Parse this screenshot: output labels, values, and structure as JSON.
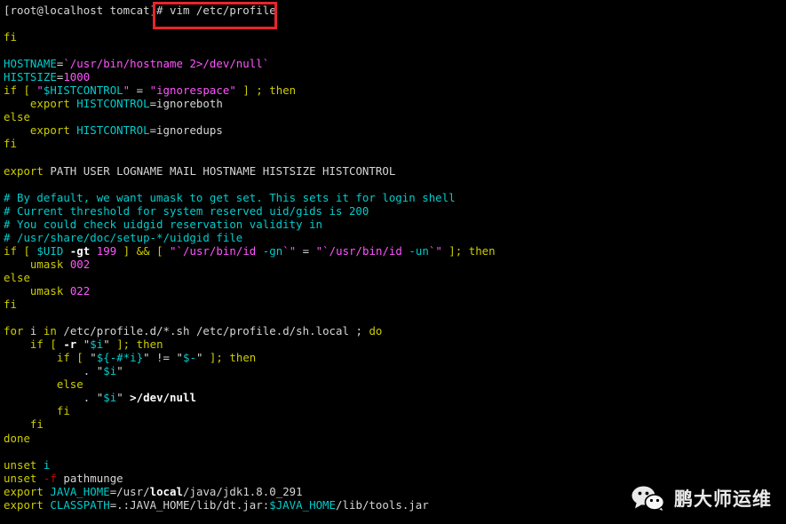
{
  "terminal": {
    "prompt": "[root@localhost tomcat]#",
    "command": "vim /etc/profile",
    "highlight_color": "#e8252a",
    "background_color": "#000000",
    "palette": {
      "white": "#d6d6d6",
      "yellow": "#cdcd00",
      "cyan": "#00cdcd",
      "magenta": "#cd00cd",
      "red": "#cd0000",
      "bold_white": "#ffffff"
    }
  },
  "file": {
    "path": "/etc/profile",
    "lines": [
      "fi",
      "",
      "HOSTNAME=`/usr/bin/hostname 2>/dev/null`",
      "HISTSIZE=1000",
      "if [ \"$HISTCONTROL\" = \"ignorespace\" ] ; then",
      "    export HISTCONTROL=ignoreboth",
      "else",
      "    export HISTCONTROL=ignoredups",
      "fi",
      "",
      "export PATH USER LOGNAME MAIL HOSTNAME HISTSIZE HISTCONTROL",
      "",
      "# By default, we want umask to get set. This sets it for login shell",
      "# Current threshold for system reserved uid/gids is 200",
      "# You could check uidgid reservation validity in",
      "# /usr/share/doc/setup-*/uidgid file",
      "if [ $UID -gt 199 ] && [ \"`/usr/bin/id -gn`\" = \"`/usr/bin/id -un`\" ]; then",
      "    umask 002",
      "else",
      "    umask 022",
      "fi",
      "",
      "for i in /etc/profile.d/*.sh /etc/profile.d/sh.local ; do",
      "    if [ -r \"$i\" ]; then",
      "        if [ \"${-#*i}\" != \"$-\" ]; then",
      "            . \"$i\"",
      "        else",
      "            . \"$i\" >/dev/null",
      "        fi",
      "    fi",
      "done",
      "",
      "unset i",
      "unset -f pathmunge",
      "export JAVA_HOME=/usr/local/java/jdk1.8.0_291",
      "export CLASSPATH=.:JAVA_HOME/lib/dt.jar:$JAVA_HOME/lib/tools.jar"
    ]
  },
  "lines": {
    "l00_prompt": "[root@localhost tomcat]#",
    "l00_cmd": " vim /etc/profile",
    "l02_fi": "fi",
    "l04_hostname_name": "HOSTNAME",
    "l04_eq": "=",
    "l04_hostname_val": "`/usr/bin/hostname 2>/dev/null`",
    "l05_histsize_name": "HISTSIZE",
    "l05_eq": "=",
    "l05_histsize_val": "1000",
    "l06_if": "if [ ",
    "l06_q1": "\"",
    "l06_var": "$HISTCONTROL",
    "l06_q2": "\"",
    "l06_eq": " = ",
    "l06_str": "\"ignorespace\"",
    "l06_tail": " ] ; then",
    "l07_indent": "    ",
    "l07_export": "export",
    "l07_sp": " ",
    "l07_var": "HISTCONTROL",
    "l07_val": "=ignoreboth",
    "l08_else": "else",
    "l09_indent": "    ",
    "l09_export": "export",
    "l09_sp": " ",
    "l09_var": "HISTCONTROL",
    "l09_val": "=ignoredups",
    "l10_fi": "fi",
    "l12_export": "export",
    "l12_rest": " PATH USER LOGNAME MAIL HOSTNAME HISTSIZE HISTCONTROL",
    "l14_comment": "# By default, we want umask to get set. This sets it for login shell",
    "l15_comment": "# Current threshold for system reserved uid/gids is 200",
    "l16_comment": "# You could check uidgid reservation validity in",
    "l17_comment": "# /usr/share/doc/setup-*/uidgid file",
    "l18_if": "if [ ",
    "l18_uid": "$UID",
    "l18_gt": " -gt ",
    "l18_199": "199",
    "l18_mid": " ] && [ ",
    "l18_q1": "\"",
    "l18_s1a": "`/usr/bin/id ",
    "l18_s1b": "-gn",
    "l18_s1c": "`",
    "l18_q2": "\"",
    "l18_eq": " = ",
    "l18_q3": "\"",
    "l18_s2a": "`/usr/bin/id ",
    "l18_s2b": "-un",
    "l18_s2c": "`",
    "l18_q4": "\"",
    "l18_tail": " ]; then",
    "l19_indent": "    ",
    "l19_umask": "umask",
    "l19_sp": " ",
    "l19_val": "002",
    "l20_else": "else",
    "l21_indent": "    ",
    "l21_umask": "umask",
    "l21_sp": " ",
    "l21_val": "022",
    "l22_fi": "fi",
    "l24_for": "for",
    "l24_i": " i ",
    "l24_in": "in",
    "l24_paths": " /etc/profile.d/*.sh /etc/profile.d/sh.local ; ",
    "l24_do": "do",
    "l25_indent": "    ",
    "l25_if": "if [ ",
    "l25_r": "-r",
    "l25_sp": " ",
    "l25_q1": "\"",
    "l25_var": "$i",
    "l25_q2": "\"",
    "l25_tail": " ]; then",
    "l26_indent": "        ",
    "l26_if": "if [ ",
    "l26_q1": "\"",
    "l26_var": "${-#*i}",
    "l26_q2": "\"",
    "l26_ne": " != ",
    "l26_q3": "\"",
    "l26_var2": "$-",
    "l26_q4": "\"",
    "l26_tail": " ]; then",
    "l27_indent": "            ",
    "l27_dot": ". ",
    "l27_q1": "\"",
    "l27_var": "$i",
    "l27_q2": "\"",
    "l28_indent": "        ",
    "l28_else": "else",
    "l29_indent": "            ",
    "l29_dot": ". ",
    "l29_q1": "\"",
    "l29_var": "$i",
    "l29_q2": "\"",
    "l29_redir": " >/dev/null",
    "l30_indent": "        ",
    "l30_fi": "fi",
    "l31_indent": "    ",
    "l31_fi": "fi",
    "l32_done": "done",
    "l34_unset": "unset",
    "l34_sp": " ",
    "l34_i": "i",
    "l35_unset": "unset",
    "l35_sp": " ",
    "l35_f": "-f",
    "l35_name": " pathmunge",
    "l36_export": "export",
    "l36_sp": " ",
    "l36_var": "JAVA_HOME",
    "l36_p1": "=/usr/",
    "l36_local": "local",
    "l36_p2": "/java/jdk1.8.0_291",
    "l37_export": "export",
    "l37_sp": " ",
    "l37_var": "CLASSPATH",
    "l37_p1": "=.:JAVA_HOME/lib/dt.jar:",
    "l37_var2": "$JAVA_HOME",
    "l37_p2": "/lib/tools.jar"
  },
  "watermark": {
    "icon": "wechat-icon",
    "text": "鹏大师运维"
  }
}
